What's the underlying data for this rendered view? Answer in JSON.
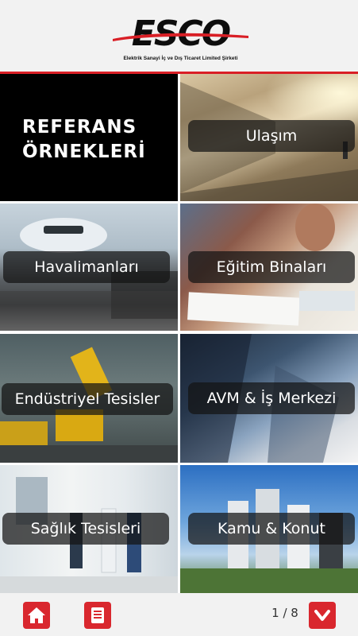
{
  "header": {
    "logo_text": "ESCO",
    "logo_subtitle": "Elektrik Sanayi İç ve Dış Ticaret Limited Şirketi",
    "accent_color": "#d91f26"
  },
  "title": {
    "line1": "REFERANS",
    "line2": "ÖRNEKLERİ"
  },
  "tiles": [
    {
      "label": "Ulaşım"
    },
    {
      "label": "Havalimanları"
    },
    {
      "label": "Eğitim Binaları"
    },
    {
      "label": "Endüstriyel Tesisler"
    },
    {
      "label": "AVM & İş Merkezi"
    },
    {
      "label": "Sağlık Tesisleri"
    },
    {
      "label": "Kamu & Konut"
    }
  ],
  "footer": {
    "page_indicator": "1 / 8",
    "home_icon": "home-icon",
    "menu_icon": "document-menu-icon",
    "next_icon": "chevron-down-icon"
  }
}
